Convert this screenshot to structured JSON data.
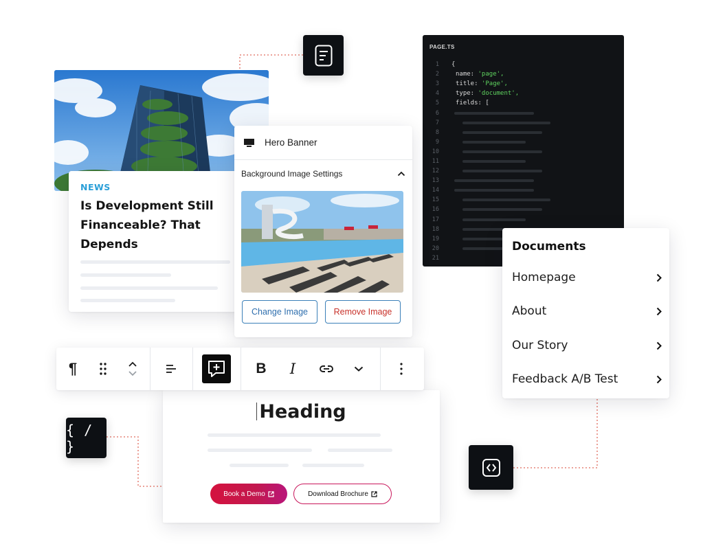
{
  "news": {
    "tag": "NEWS",
    "title": "Is Development Still Financeable? That Depends"
  },
  "code": {
    "filename": "PAGE.TS",
    "lines": [
      {
        "n": "1",
        "key": "{",
        "str": ""
      },
      {
        "n": "2",
        "key": "name: ",
        "str": "'page',"
      },
      {
        "n": "3",
        "key": "title: ",
        "str": "'Page',"
      },
      {
        "n": "4",
        "key": "type: ",
        "str": "'document',"
      },
      {
        "n": "5",
        "key": "fields: [",
        "str": ""
      },
      {
        "n": "6"
      },
      {
        "n": "7"
      },
      {
        "n": "8"
      },
      {
        "n": "9"
      },
      {
        "n": "10"
      },
      {
        "n": "11"
      },
      {
        "n": "12"
      },
      {
        "n": "13"
      },
      {
        "n": "14"
      },
      {
        "n": "15"
      },
      {
        "n": "16"
      },
      {
        "n": "17"
      },
      {
        "n": "18"
      },
      {
        "n": "19"
      },
      {
        "n": "20"
      },
      {
        "n": "21"
      }
    ]
  },
  "hero": {
    "title": "Hero Banner",
    "section_label": "Background Image Settings",
    "change_label": "Change Image",
    "remove_label": "Remove Image"
  },
  "toolbar": {
    "paragraph_symbol": "¶",
    "bold": "B",
    "italic": "I"
  },
  "heading_block": {
    "heading": "Heading",
    "primary_cta": "Book a Demo",
    "secondary_cta": "Download Brochure"
  },
  "documents": {
    "title": "Documents",
    "items": [
      "Homepage",
      "About",
      "Our Story",
      "Feedback A/B Test"
    ]
  },
  "tiles": {
    "code_braces": "{ / }"
  },
  "colors": {
    "accent_blue": "#2a9fd8",
    "cta_gradient_start": "#d4123e",
    "cta_gradient_end": "#b9167a",
    "remove_red": "#c8322a",
    "connector": "#e06a5c"
  }
}
